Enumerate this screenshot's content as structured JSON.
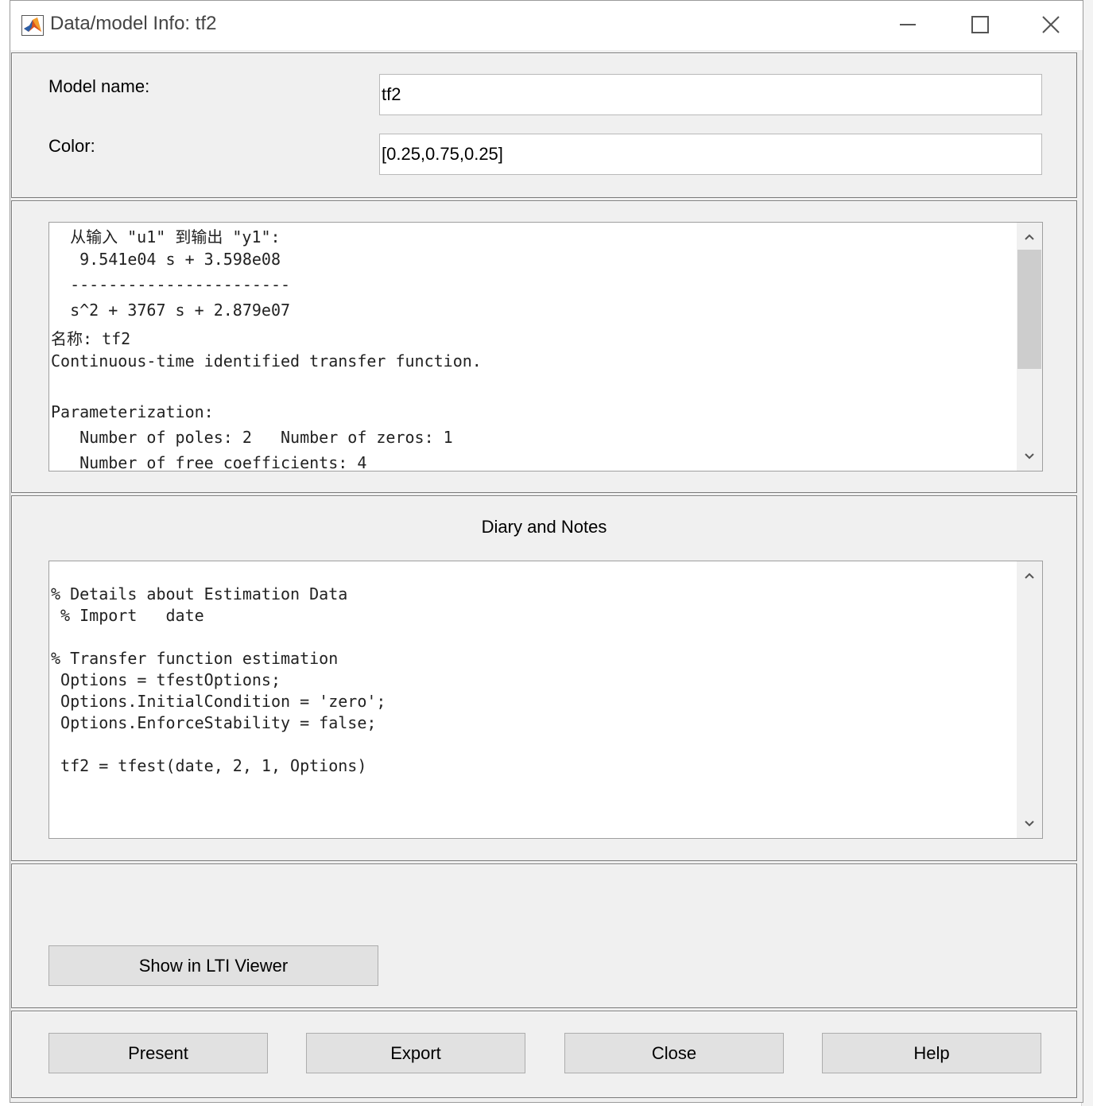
{
  "window": {
    "title": "Data/model Info: tf2",
    "controls": {
      "minimize_icon": "minimize-icon",
      "maximize_icon": "maximize-icon",
      "close_icon": "close-icon"
    }
  },
  "model_panel": {
    "name_label": "Model name:",
    "name_value": "tf2",
    "color_label": "Color:",
    "color_value": "[0.25,0.75,0.25]"
  },
  "info_text": {
    "lines": [
      "  从输入 \"u1\" 到输出 \"y1\":",
      "   9.541e04 s + 3.598e08",
      "  -----------------------",
      "  s^2 + 3767 s + 2.879e07",
      "名称: tf2",
      "Continuous-time identified transfer function.",
      "",
      "Parameterization:",
      "   Number of poles: 2   Number of zeros: 1",
      "   Number of free coefficients: 4"
    ]
  },
  "diary": {
    "heading": "Diary and Notes",
    "lines": [
      "",
      "% Details about Estimation Data",
      " % Import   date",
      "",
      "% Transfer function estimation",
      " Options = tfestOptions;",
      " Options.InitialCondition = 'zero';",
      " Options.EnforceStability = false;",
      "",
      " tf2 = tfest(date, 2, 1, Options)"
    ]
  },
  "lti_button": {
    "label": "Show in LTI Viewer"
  },
  "footer": {
    "present_label": "Present",
    "export_label": "Export",
    "close_label": "Close",
    "help_label": "Help"
  }
}
